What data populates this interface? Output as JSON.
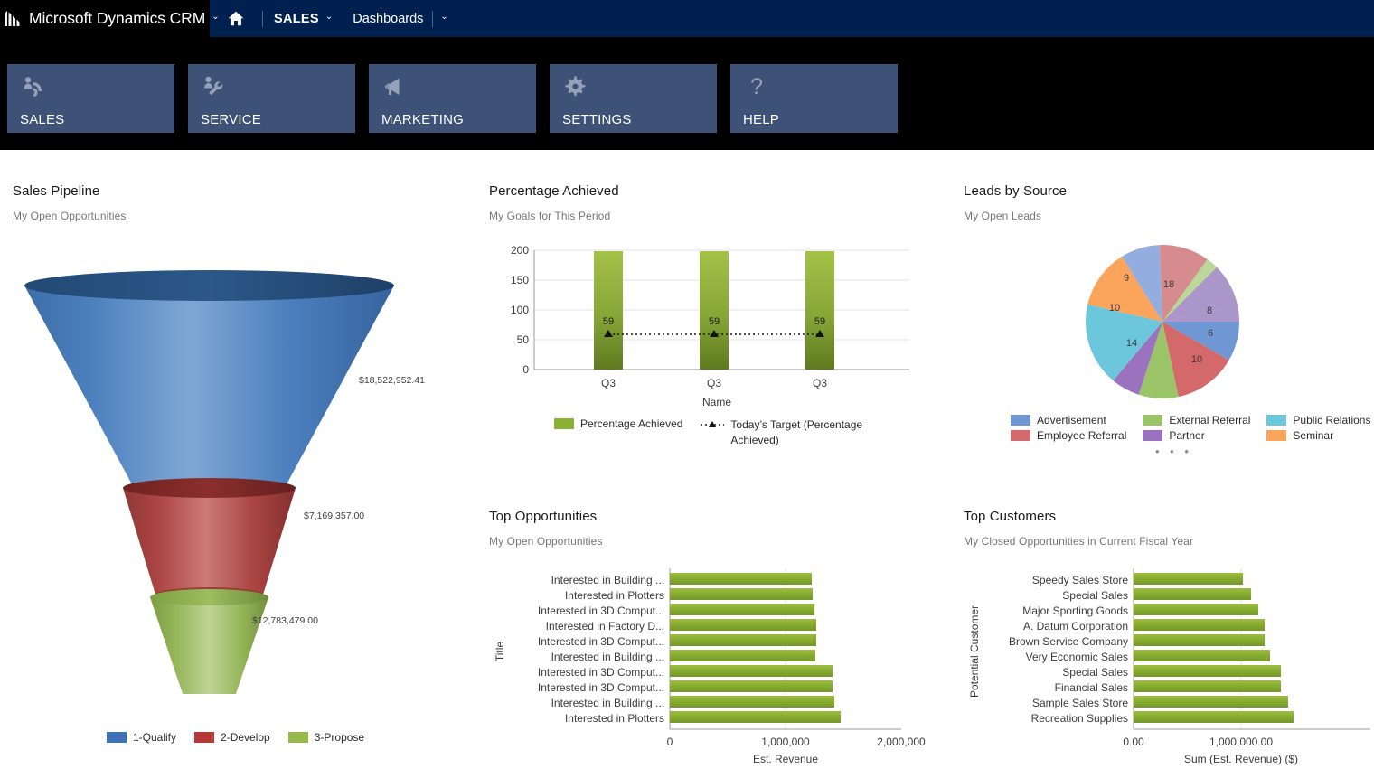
{
  "topbar": {
    "brand": "Microsoft Dynamics CRM",
    "brand_caret": "⌄",
    "home_icon": "home-icon",
    "sales": "SALES",
    "sales_caret": "⌄",
    "dashboards": "Dashboards",
    "dashboards_caret": "⌄"
  },
  "tiles": [
    {
      "label": "SALES",
      "icon": "person-phone-icon"
    },
    {
      "label": "SERVICE",
      "icon": "person-wrench-icon"
    },
    {
      "label": "MARKETING",
      "icon": "megaphone-icon"
    },
    {
      "label": "SETTINGS",
      "icon": "gear-icon"
    },
    {
      "label": "HELP",
      "icon": "question-mark-icon"
    }
  ],
  "colors": {
    "brand_navy": "#002050",
    "tile_blue": "#3e5277",
    "funnel_blue": "#4a7ebb",
    "funnel_red": "#b94a48",
    "funnel_green": "#9bbb59",
    "bar_green": "#8bb033",
    "black": "#000000"
  },
  "panels": {
    "sales_pipeline": {
      "title": "Sales Pipeline",
      "subtitle": "My Open Opportunities"
    },
    "percentage_achieved": {
      "title": "Percentage Achieved",
      "subtitle": "My Goals for This Period"
    },
    "leads_by_source": {
      "title": "Leads by Source",
      "subtitle": "My Open Leads"
    },
    "top_opportunities": {
      "title": "Top Opportunities",
      "subtitle": "My Open Opportunities"
    },
    "top_customers": {
      "title": "Top Customers",
      "subtitle": "My Closed Opportunities in Current Fiscal Year"
    }
  },
  "chart_data": [
    {
      "id": "sales-pipeline-funnel",
      "type": "funnel",
      "title": "Sales Pipeline",
      "subtitle": "My Open Opportunities",
      "categories": [
        "1-Qualify",
        "2-Develop",
        "3-Propose"
      ],
      "values": [
        18522952.41,
        7169357.0,
        12783479.0
      ],
      "labels": [
        "$18,522,952.41",
        "$7,169,357.00",
        "$12,783,479.00"
      ],
      "colors": [
        "#4a7ebb",
        "#b94a48",
        "#9bbb59"
      ],
      "legend": [
        "1-Qualify",
        "2-Develop",
        "3-Propose"
      ],
      "legend_position": "bottom"
    },
    {
      "id": "percentage-achieved-bar",
      "type": "bar",
      "title": "Percentage Achieved",
      "subtitle": "My Goals for This Period",
      "categories": [
        "Q3",
        "Q3",
        "Q3"
      ],
      "values": [
        198,
        198,
        198
      ],
      "target_values": [
        59,
        59,
        59
      ],
      "target_labels": [
        "59",
        "59",
        "59"
      ],
      "xlabel": "Name",
      "ylabel": "",
      "ylim": [
        0,
        200
      ],
      "yticks": [
        "0",
        "50",
        "100",
        "150",
        "200"
      ],
      "grid": true,
      "legend": [
        "Percentage Achieved",
        "Today’s Target (Percentage Achieved)"
      ],
      "legend_position": "bottom",
      "series_color": "#8bb033"
    },
    {
      "id": "leads-by-source-pie",
      "type": "pie",
      "title": "Leads by Source",
      "subtitle": "My Open Leads",
      "slices": [
        {
          "label": "Employee Referral",
          "value": 18,
          "shown": "18",
          "color": "#d68b8e"
        },
        {
          "label": "External Referral",
          "value": 5,
          "shown": "",
          "color": "#bcd79a"
        },
        {
          "label": "Partner",
          "value": 8,
          "shown": "8",
          "color": "#ab96c9"
        },
        {
          "label": "Advertisement",
          "value": 6,
          "shown": "6",
          "color": "#6f97d4"
        },
        {
          "label": "Employee Referral",
          "value": 10,
          "shown": "10",
          "color": "#d4696b"
        },
        {
          "label": "External Referral",
          "value": 7,
          "shown": "",
          "color": "#9bc468"
        },
        {
          "label": "Partner",
          "value": 5,
          "shown": "",
          "color": "#9a72bd"
        },
        {
          "label": "Public Relations",
          "value": 14,
          "shown": "14",
          "color": "#6cc7dd"
        },
        {
          "label": "Seminar",
          "value": 10,
          "shown": "10",
          "color": "#fba košice",
          "color_hex": "#fba45c"
        },
        {
          "label": "Advertisement",
          "value": 9,
          "shown": "9",
          "color": "#93aede"
        }
      ],
      "legend": [
        {
          "label": "Advertisement",
          "color": "#6f97d4"
        },
        {
          "label": "External Referral",
          "color": "#9bc468"
        },
        {
          "label": "Public Relations",
          "color": "#6cc7dd"
        },
        {
          "label": "Employee Referral",
          "color": "#d4696b"
        },
        {
          "label": "Partner",
          "color": "#9a72bd"
        },
        {
          "label": "Seminar",
          "color": "#fba45c"
        }
      ],
      "legend_position": "bottom",
      "pager_dots": 3
    },
    {
      "id": "top-opportunities-bar",
      "type": "bar",
      "orientation": "horizontal",
      "title": "Top Opportunities",
      "subtitle": "My Open Opportunities",
      "categories": [
        "Interested in Building ...",
        "Interested in Plotters",
        "Interested in 3D Comput...",
        "Interested in Factory D...",
        "Interested in 3D Comput...",
        "Interested in Building ...",
        "Interested in 3D Comput...",
        "Interested in 3D Comput...",
        "Interested in Building ...",
        "Interested in Plotters"
      ],
      "values": [
        1225000,
        1232000,
        1252000,
        1265000,
        1262000,
        1260000,
        1410000,
        1405000,
        1420000,
        1480000
      ],
      "xlabel": "Est. Revenue",
      "ylabel": "Title",
      "xlim": [
        0,
        2000000
      ],
      "xticks": [
        "0",
        "1,000,000",
        "2,000,000"
      ],
      "series_color": "#8bb033"
    },
    {
      "id": "top-customers-bar",
      "type": "bar",
      "orientation": "horizontal",
      "title": "Top Customers",
      "subtitle": "My Closed Opportunities in Current Fiscal Year",
      "categories": [
        "Speedy Sales Store",
        "Special Sales",
        "Major Sporting Goods",
        "A. Datum Corporation",
        "Brown Service Company",
        "Very Economic Sales",
        "Special Sales",
        "Financial Sales",
        "Sample Sales Store",
        "Recreation Supplies"
      ],
      "values": [
        1020000,
        1095000,
        1160000,
        1215000,
        1218000,
        1265000,
        1370000,
        1368000,
        1430000,
        1485000
      ],
      "xlabel": "Sum (Est. Revenue) ($)",
      "ylabel": "Potential Customer",
      "xlim": [
        0,
        1600000
      ],
      "xticks": [
        "0.00",
        "1,000,000.00"
      ],
      "series_color": "#8bb033"
    }
  ]
}
